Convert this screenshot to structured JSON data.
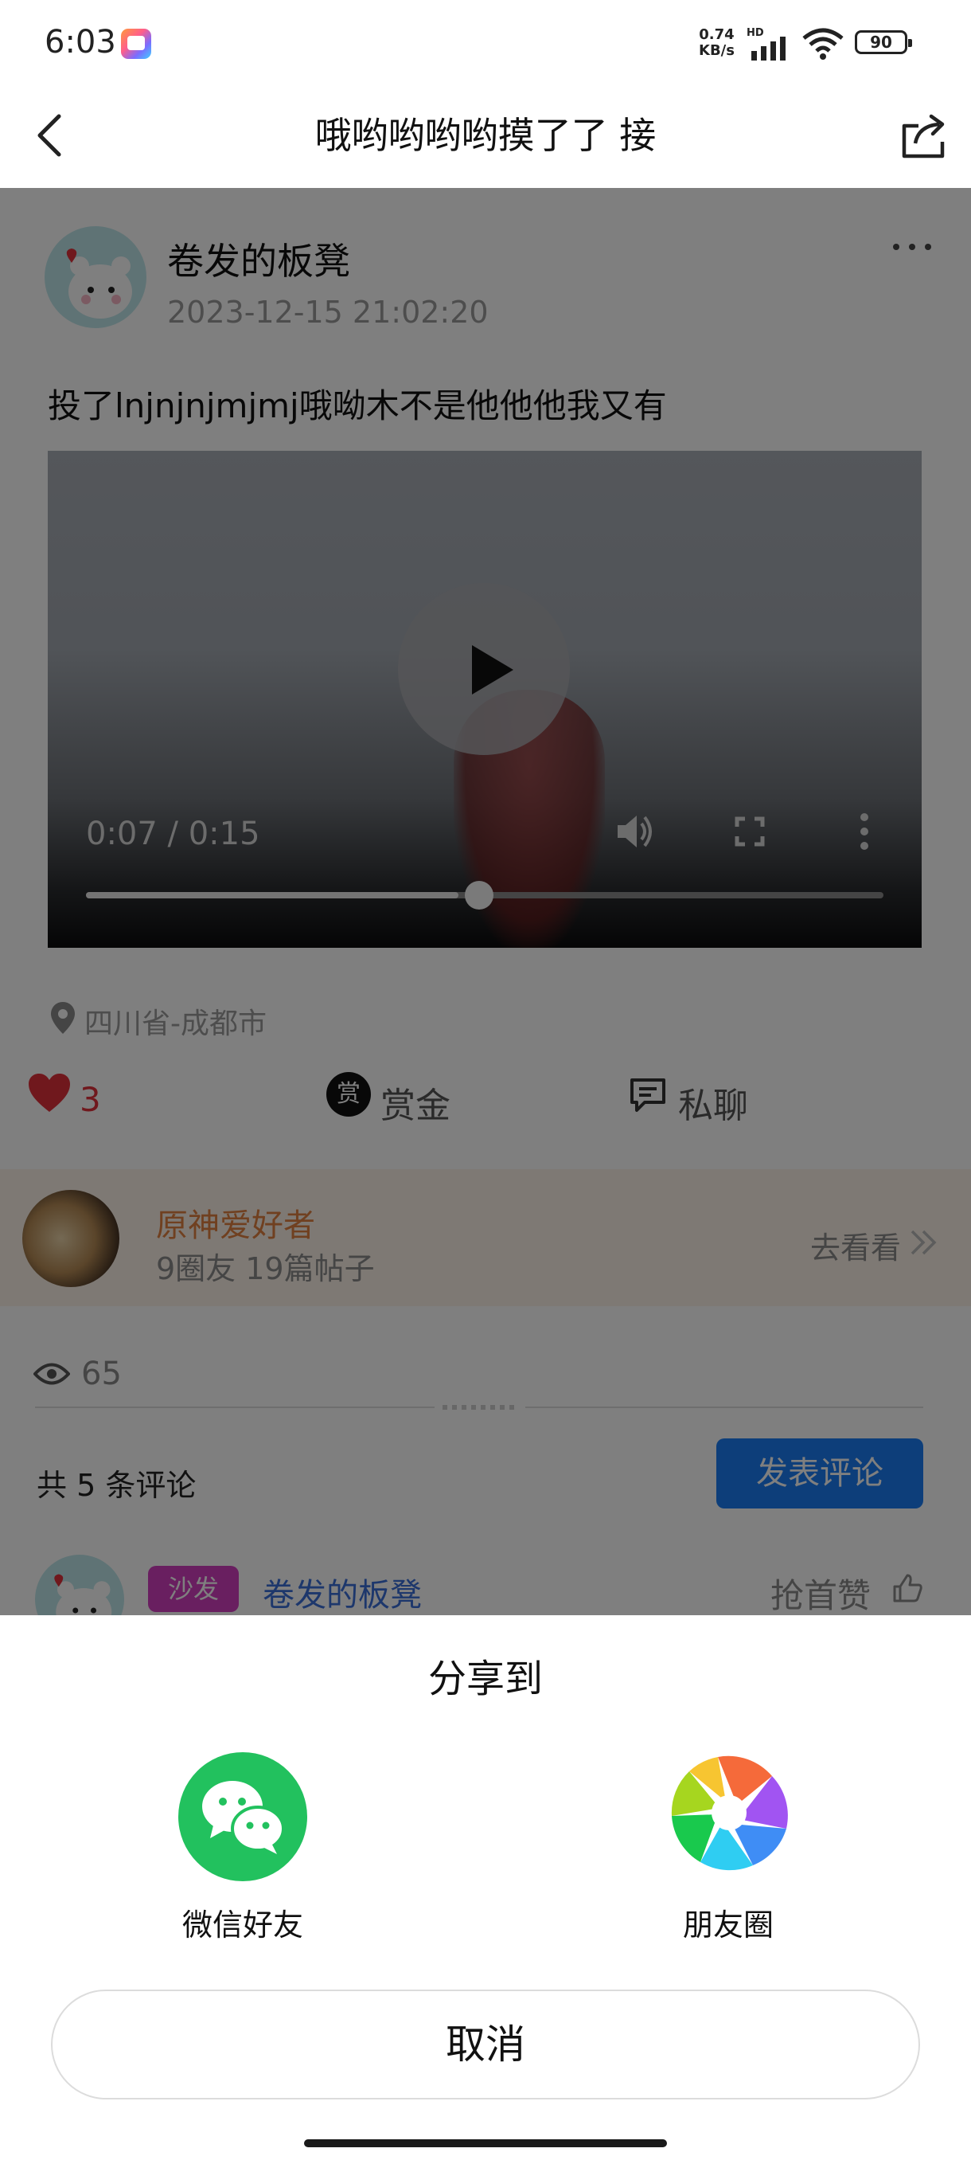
{
  "status_bar": {
    "time": "6:03",
    "net_speed_value": "0.74",
    "net_speed_unit": "KB/s",
    "network_label": "HD",
    "battery": "90"
  },
  "nav": {
    "title": "哦哟哟哟哟摸了了 接"
  },
  "post": {
    "author": "卷发的板凳",
    "time": "2023-12-15 21:02:20",
    "text": "投了lnjnjnjmjmj哦呦木不是他他他我又有",
    "location": "四川省-成都市"
  },
  "video": {
    "time_label": "0:07 / 0:15",
    "progress": 0.467
  },
  "actions": {
    "like_count": "3",
    "reward_icon_char": "赏",
    "reward_label": "赏金",
    "chat_label": "私聊"
  },
  "circle": {
    "name": "原神爱好者",
    "stats": "9圈友   19篇帖子",
    "go_label": "去看看"
  },
  "stats": {
    "views": "65"
  },
  "comments": {
    "count_label": "共 5 条评论",
    "post_button": "发表评论",
    "first": {
      "badge": "沙发",
      "name": "卷发的板凳",
      "first_like_label": "抢首赞"
    }
  },
  "share_sheet": {
    "title": "分享到",
    "options": [
      {
        "label": "微信好友",
        "icon": "wechat-icon"
      },
      {
        "label": "朋友圈",
        "icon": "moments-icon"
      }
    ],
    "cancel": "取消"
  },
  "colors": {
    "accent_blue": "#1a7cf5",
    "like_red": "#e0303a",
    "wechat_green": "#22c15e",
    "circle_orange": "#e08040",
    "sofa_badge": "#d23fc0"
  }
}
